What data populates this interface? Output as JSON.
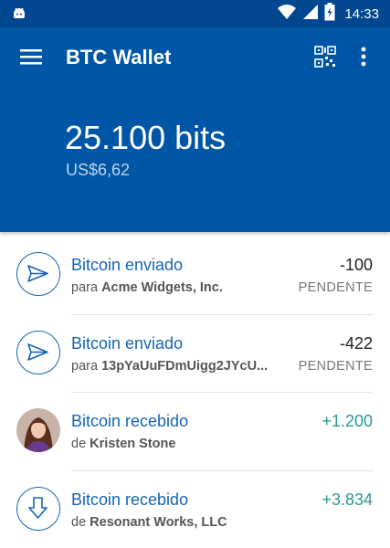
{
  "status_bar": {
    "time": "14:33",
    "icons": [
      "android-icon",
      "wifi-icon",
      "signal-icon",
      "battery-charging-icon"
    ]
  },
  "app_bar": {
    "title": "BTC Wallet",
    "icons": [
      "menu-icon",
      "qr-code-icon",
      "more-vert-icon"
    ]
  },
  "balance": {
    "amount": "25.100 bits",
    "fiat": "US$6,62"
  },
  "colors": {
    "primary": "#0056a6",
    "status_bar": "#00478f",
    "link_blue": "#1565b5",
    "positive_green": "#2a9a94"
  },
  "transactions": [
    {
      "title": "Bitcoin enviado",
      "preposition": "para",
      "party": "Acme Widgets, Inc.",
      "amount": "-100",
      "status": "PENDENTE",
      "icon": "send-icon"
    },
    {
      "title": "Bitcoin enviado",
      "preposition": "para",
      "party": "13pYaUuFDmUigg2JYcU...",
      "amount": "-422",
      "status": "PENDENTE",
      "icon": "send-icon"
    },
    {
      "title": "Bitcoin recebido",
      "preposition": "de",
      "party": "Kristen Stone",
      "amount": "+1.200",
      "status": "",
      "icon": "avatar"
    },
    {
      "title": "Bitcoin recebido",
      "preposition": "de",
      "party": "Resonant Works, LLC",
      "amount": "+3.834",
      "status": "",
      "icon": "receive-icon"
    }
  ]
}
